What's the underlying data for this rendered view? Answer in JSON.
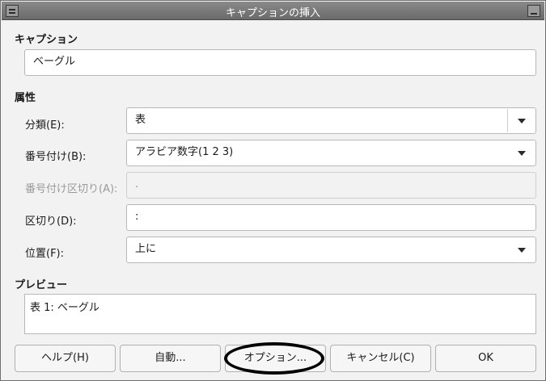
{
  "window": {
    "title": "キャプションの挿入"
  },
  "caption": {
    "section_label": "キャプション",
    "value": "ベーグル"
  },
  "properties": {
    "section_label": "属性",
    "category": {
      "label": "分類(E):",
      "value": "表"
    },
    "numbering": {
      "label": "番号付け(B):",
      "value": "アラビア数字(1 2 3)"
    },
    "numbering_separator": {
      "label": "番号付け区切り(A):",
      "value": "."
    },
    "separator": {
      "label": "区切り(D):",
      "value": ":"
    },
    "position": {
      "label": "位置(F):",
      "value": "上に"
    }
  },
  "preview": {
    "section_label": "プレビュー",
    "text": "表 1: ベーグル"
  },
  "buttons": {
    "help": "ヘルプ(H)",
    "auto": "自動...",
    "options": "オプション...",
    "cancel": "キャンセル(C)",
    "ok": "OK"
  },
  "colors": {
    "titlebar": "#7a7a7a",
    "annotation": "#000000"
  }
}
